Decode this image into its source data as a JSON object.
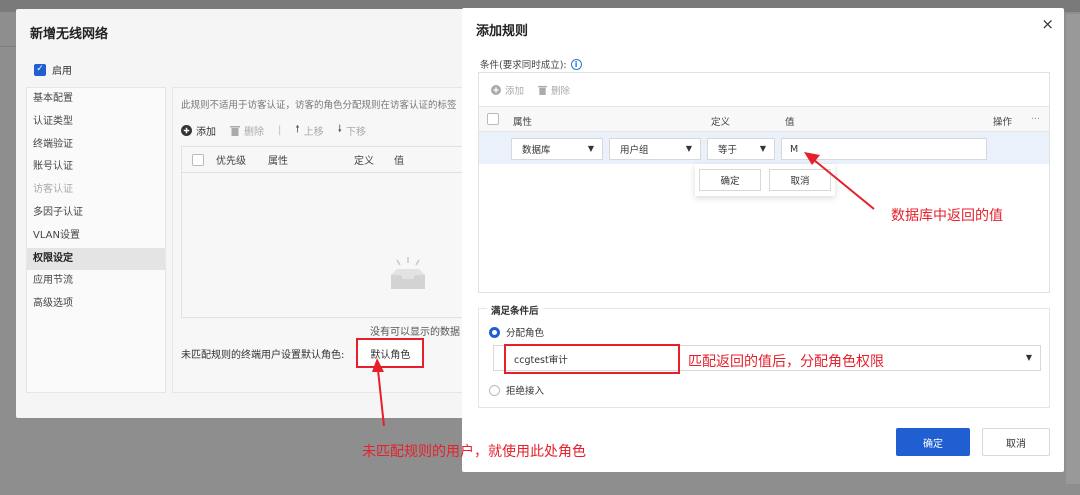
{
  "left_dialog": {
    "title": "新增无线网络",
    "enable_label": "启用",
    "nav_items": [
      {
        "label": "基本配置",
        "state": "normal"
      },
      {
        "label": "认证类型",
        "state": "normal"
      },
      {
        "label": "终端验证",
        "state": "normal"
      },
      {
        "label": "账号认证",
        "state": "normal"
      },
      {
        "label": "访客认证",
        "state": "disabled"
      },
      {
        "label": "多因子认证",
        "state": "normal"
      },
      {
        "label": "VLAN设置",
        "state": "normal"
      },
      {
        "label": "权限设定",
        "state": "active"
      },
      {
        "label": "应用节流",
        "state": "normal"
      },
      {
        "label": "高级选项",
        "state": "normal"
      }
    ],
    "perm_note": "此规则不适用于访客认证，访客的角色分配规则在访客认证的标签",
    "toolbar": {
      "add": "添加",
      "delete": "删除",
      "sep": "|",
      "up": "上移",
      "down": "下移"
    },
    "grid_headers": {
      "priority": "优先级",
      "attr": "属性",
      "define": "定义",
      "value": "值"
    },
    "empty_text": "没有可以显示的数据",
    "default_label": "未匹配规则的终端用户设置默认角色:",
    "default_button": "默认角色"
  },
  "right_dialog": {
    "title": "添加规则",
    "close": "×",
    "conditions_label": "条件(要求同时成立):",
    "info_icon": "i",
    "toolbar": {
      "add": "添加",
      "delete": "删除"
    },
    "headers": {
      "attr": "属性",
      "define": "定义",
      "value": "值",
      "ops": "操作",
      "more": "···"
    },
    "row": {
      "source": "数据库",
      "attribute": "用户组",
      "operator": "等于",
      "value": "M"
    },
    "pop_confirm": "确定",
    "pop_cancel": "取消",
    "after_title": "满足条件后",
    "assign_role": "分配角色",
    "role_value": "ccgtest审计",
    "reject": "拒绝接入",
    "ok": "确定",
    "cancel": "取消"
  },
  "annotations": {
    "db_value": "数据库中返回的值",
    "match_role": "匹配返回的值后，分配角色权限",
    "default_role": "未匹配规则的用户，就使用此处角色"
  },
  "colors": {
    "accent": "#1f5fd1",
    "highlight_red": "#e6202b",
    "row_selected": "#eaf1fb"
  }
}
